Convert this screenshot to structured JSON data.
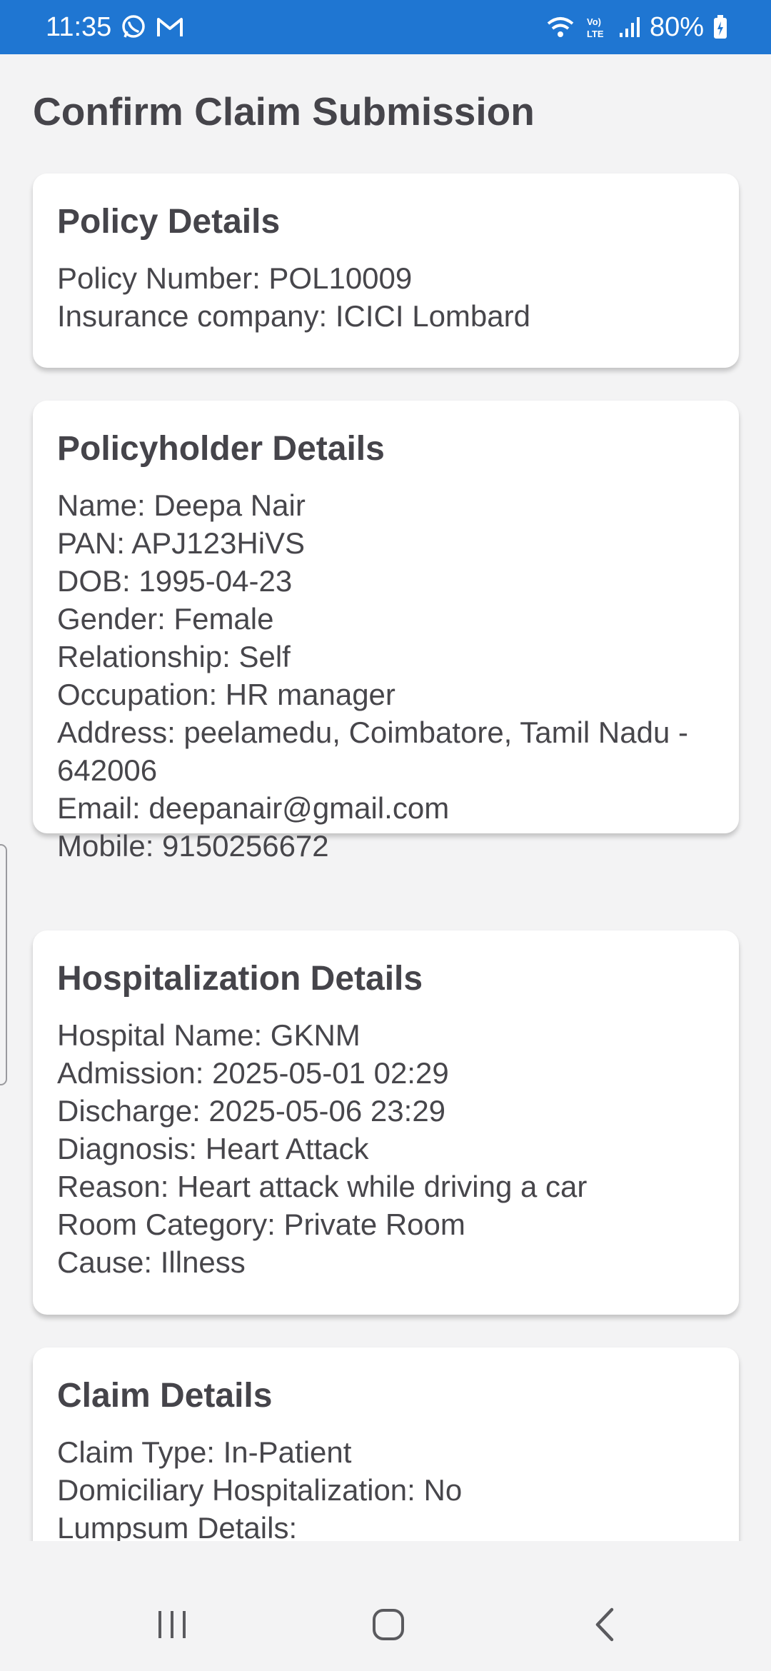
{
  "status_bar": {
    "time": "11:35",
    "battery": "80%",
    "icons_left": [
      "whatsapp-icon",
      "gmail-icon"
    ],
    "icons_right": [
      "wifi-icon",
      "volte-icon",
      "signal-icon",
      "battery-icon"
    ]
  },
  "page": {
    "title": "Confirm Claim Submission"
  },
  "policy": {
    "heading": "Policy Details",
    "rows": [
      "Policy Number: POL10009",
      "Insurance company: ICICI Lombard"
    ]
  },
  "policyholder": {
    "heading": "Policyholder Details",
    "rows": [
      "Name: Deepa Nair",
      "PAN: APJ123HiVS",
      "DOB: 1995-04-23",
      "Gender: Female",
      "Relationship: Self",
      "Occupation: HR manager",
      "Address: peelamedu, Coimbatore, Tamil Nadu - 642006",
      "Email: deepanair@gmail.com",
      "Mobile: 9150256672"
    ]
  },
  "hospitalization": {
    "heading": "Hospitalization Details",
    "rows": [
      "Hospital Name: GKNM",
      "Admission: 2025-05-01 02:29",
      "Discharge: 2025-05-06 23:29",
      "Diagnosis: Heart Attack",
      "Reason: Heart attack while driving a car",
      "Room Category: Private Room",
      "Cause: Illness"
    ]
  },
  "claim": {
    "heading": "Claim Details",
    "rows": [
      "Claim Type: In-Patient",
      "Domiciliary Hospitalization: No",
      "Lumpsum Details:"
    ]
  },
  "nav": {
    "icons": [
      "recent-apps-icon",
      "home-icon",
      "back-icon"
    ]
  }
}
